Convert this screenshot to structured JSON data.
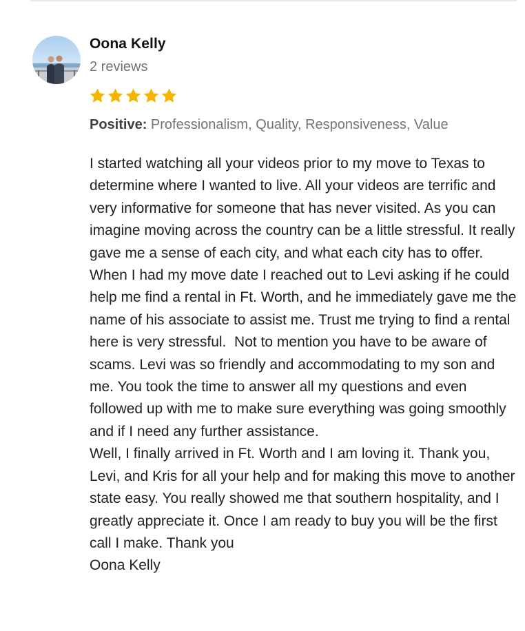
{
  "review": {
    "reviewer_name": "Oona Kelly",
    "review_count": "2 reviews",
    "rating": 5,
    "max_rating": 5,
    "star_color": "#f4b400",
    "attributes": {
      "label": "Positive:",
      "value": "Professionalism, Quality, Responsiveness, Value"
    },
    "paragraphs": [
      "I started watching all your videos prior to my move to Texas to determine where I wanted to live. All your videos are terrific and very informative for someone that has never visited. As you can imagine moving across the country can be a little stressful. It really gave me a sense of each city, and what each city has to offer.",
      "When I had my move date I reached out to Levi asking if he could help me find a rental in Ft. Worth, and he immediately gave me the name of his associate to assist me. Trust me trying to find a rental here is very stressful.  Not to mention you have to be aware of scams. Levi was so friendly and accommodating to my son and me. You took the time to answer all my questions and even followed up with me to make sure everything was going smoothly and if I need any further assistance.",
      "Well, I finally arrived in Ft. Worth and I am loving it. Thank you, Levi, and Kris for all your help and for making this move to another state easy. You really showed me that southern hospitality, and I greatly appreciate it. Once I am ready to buy you will be the first call I make. Thank you",
      "Oona Kelly"
    ]
  }
}
